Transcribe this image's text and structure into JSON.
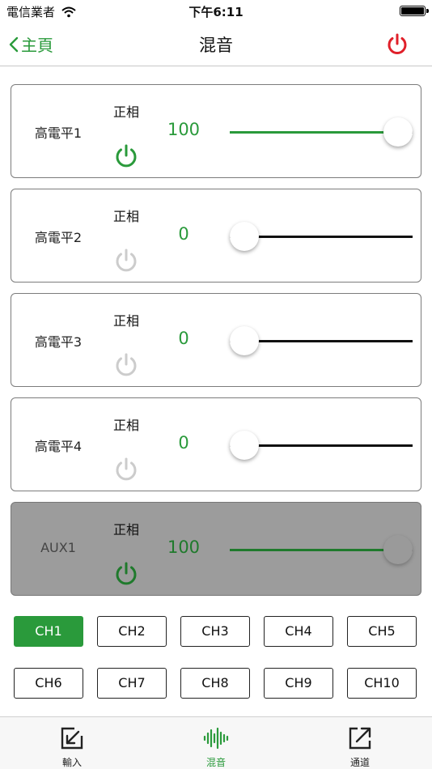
{
  "status_bar": {
    "carrier": "電信業者",
    "time": "下午6:11"
  },
  "nav": {
    "back_label": "主頁",
    "title": "混音"
  },
  "colors": {
    "accent": "#2a9a3b",
    "power_red": "#e0202a",
    "power_off": "#cccccc",
    "disabled_bg": "#9c9c9c"
  },
  "channels": [
    {
      "name": "高電平1",
      "phase": "正相",
      "level": "100",
      "power": "on",
      "slider": 1.0,
      "disabled": false
    },
    {
      "name": "高電平2",
      "phase": "正相",
      "level": "0",
      "power": "off",
      "slider": 0.0,
      "disabled": false
    },
    {
      "name": "高電平3",
      "phase": "正相",
      "level": "0",
      "power": "off",
      "slider": 0.0,
      "disabled": false
    },
    {
      "name": "高電平4",
      "phase": "正相",
      "level": "0",
      "power": "off",
      "slider": 0.0,
      "disabled": false
    },
    {
      "name": "AUX1",
      "phase": "正相",
      "level": "100",
      "power": "on",
      "slider": 1.0,
      "disabled": true
    }
  ],
  "ch_buttons": [
    "CH1",
    "CH2",
    "CH3",
    "CH4",
    "CH5",
    "CH6",
    "CH7",
    "CH8",
    "CH9",
    "CH10"
  ],
  "active_channel": "CH1",
  "tabs": [
    {
      "label": "輸入",
      "icon": "input-arrow-icon",
      "active": false
    },
    {
      "label": "混音",
      "icon": "waveform-icon",
      "active": true
    },
    {
      "label": "通道",
      "icon": "output-arrow-icon",
      "active": false
    }
  ]
}
